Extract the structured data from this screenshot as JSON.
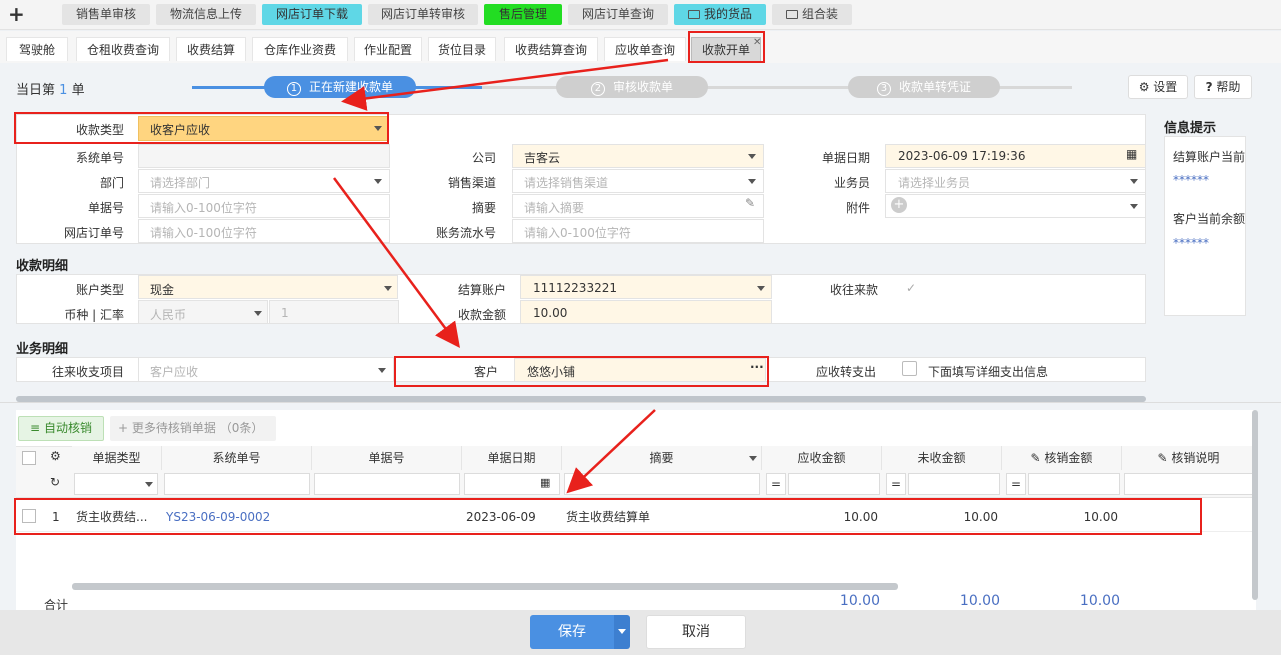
{
  "top_tabs": [
    "销售单审核",
    "物流信息上传",
    "网店订单下载",
    "网店订单转审核",
    "售后管理",
    "网店订单查询",
    "我的货品",
    "组合装"
  ],
  "sub_tabs": [
    "驾驶舱",
    "仓租收费查询",
    "收费结算",
    "仓库作业资费",
    "作业配置",
    "货位目录",
    "收费结算查询",
    "应收单查询",
    "收款开单"
  ],
  "header": {
    "day_prefix": "当日第",
    "day_count": "1",
    "day_suffix": "单",
    "settings": "设置",
    "help": "帮助"
  },
  "steps": [
    {
      "num": "1",
      "label": "正在新建收款单"
    },
    {
      "num": "2",
      "label": "审核收款单"
    },
    {
      "num": "3",
      "label": "收款单转凭证"
    }
  ],
  "form": {
    "type_label": "收款类型",
    "type_value": "收客户应收",
    "sysno_label": "系统单号",
    "company_label": "公司",
    "company_value": "吉客云",
    "date_label": "单据日期",
    "date_value": "2023-06-09 17:19:36",
    "dept_label": "部门",
    "dept_ph": "请选择部门",
    "channel_label": "销售渠道",
    "channel_ph": "请选择销售渠道",
    "clerk_label": "业务员",
    "clerk_ph": "请选择业务员",
    "billno_label": "单据号",
    "billno_ph": "请输入0-100位字符",
    "summary_label": "摘要",
    "summary_ph": "请输入摘要",
    "attach_label": "附件",
    "shopno_label": "网店订单号",
    "shopno_ph": "请输入0-100位字符",
    "flow_label": "账务流水号",
    "flow_ph": "请输入0-100位字符"
  },
  "detail": {
    "title": "收款明细",
    "acct_type_label": "账户类型",
    "acct_type_value": "现金",
    "settle_label": "结算账户",
    "settle_value": "11112233221",
    "intercourse_label": "收往来款",
    "currency_label": "币种 | 汇率",
    "currency_value": "人民币",
    "rate_value": "1",
    "amount_label": "收款金额",
    "amount_value": "10.00"
  },
  "business": {
    "title": "业务明细",
    "item_label": "往来收支项目",
    "item_value": "客户应收",
    "customer_label": "客户",
    "customer_value": "悠悠小铺",
    "transfer_label": "应收转支出",
    "transfer_text": "下面填写详细支出信息"
  },
  "info": {
    "title": "信息提示",
    "line1": "结算账户当前",
    "stars1": "******",
    "line2": "客户当前余额",
    "stars2": "******"
  },
  "table": {
    "auto_btn": "自动核销",
    "more_btn": "更多待核销单据",
    "more_count": "（0条）",
    "headers": [
      "单据类型",
      "系统单号",
      "单据号",
      "单据日期",
      "摘要",
      "应收金额",
      "未收金额",
      "核销金额",
      "核销说明"
    ],
    "row": {
      "idx": "1",
      "type": "货主收费结...",
      "sysno": "YS23-06-09-0002",
      "billno": "",
      "date": "2023-06-09",
      "summary": "货主收费结算单",
      "receivable": "10.00",
      "unreceived": "10.00",
      "writeoff": "10.00"
    },
    "total_label": "合计",
    "totals": [
      "10.00",
      "10.00",
      "10.00"
    ]
  },
  "footer": {
    "save": "保存",
    "cancel": "取消"
  },
  "colors": {
    "accent": "#4a90e2",
    "highlight": "#e8211c",
    "yellow": "#ffd580"
  }
}
